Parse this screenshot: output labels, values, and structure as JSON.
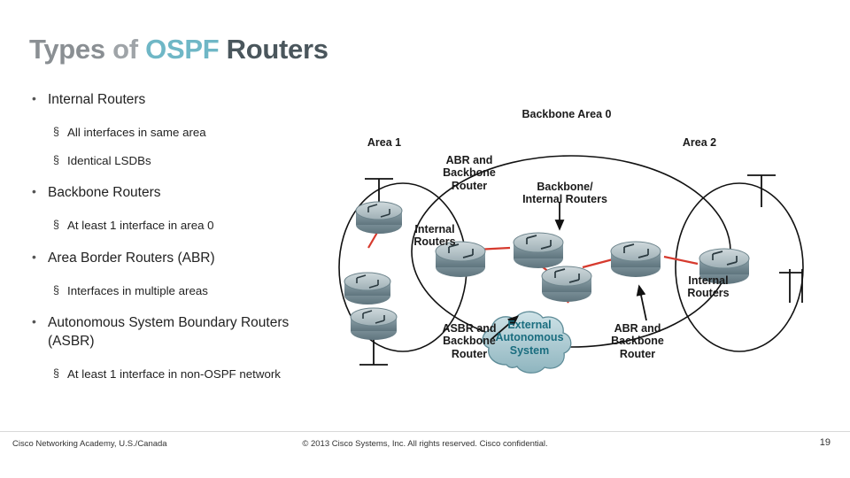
{
  "slide": {
    "title_words": [
      "Types",
      "of",
      "OSPF",
      "Routers"
    ],
    "bullets": [
      {
        "level": 1,
        "text": "Internal Routers"
      },
      {
        "level": 2,
        "text": "All interfaces in same area"
      },
      {
        "level": 2,
        "text": "Identical LSDBs"
      },
      {
        "level": 1,
        "text": "Backbone Routers"
      },
      {
        "level": 2,
        "text": "At least 1 interface in area 0"
      },
      {
        "level": 1,
        "text": "Area Border Routers (ABR)"
      },
      {
        "level": 2,
        "text": "Interfaces in multiple areas"
      },
      {
        "level": 1,
        "text": "Autonomous System Boundary Routers (ASBR)"
      },
      {
        "level": 2,
        "text": "At least 1 interface in non-OSPF network"
      }
    ],
    "diagram": {
      "labels": {
        "backbone_area": "Backbone Area 0",
        "area1": "Area 1",
        "area2": "Area 2",
        "abr_backbone_left": "ABR and\nBackbone\nRouter",
        "backbone_internal": "Backbone/\nInternal Routers",
        "internal_routers_left": "Internal\nRouters",
        "internal_routers_right": "Internal\nRouters",
        "asbr_backbone": "ASBR and\nBackbone\nRouter",
        "external_as": "External\nAutonomous\nSystem",
        "abr_backbone_right": "ABR and\nBackbone\nRouter"
      }
    },
    "footer": {
      "left": "Cisco Networking Academy, U.S./Canada",
      "center": "© 2013 Cisco Systems, Inc. All rights reserved. Cisco confidential.",
      "page": "19"
    },
    "colors": {
      "title_accent": "#6fb7c6",
      "title_dark": "#4a565c",
      "link_red": "#d63a2e",
      "router_body": "#7e98a0"
    }
  }
}
